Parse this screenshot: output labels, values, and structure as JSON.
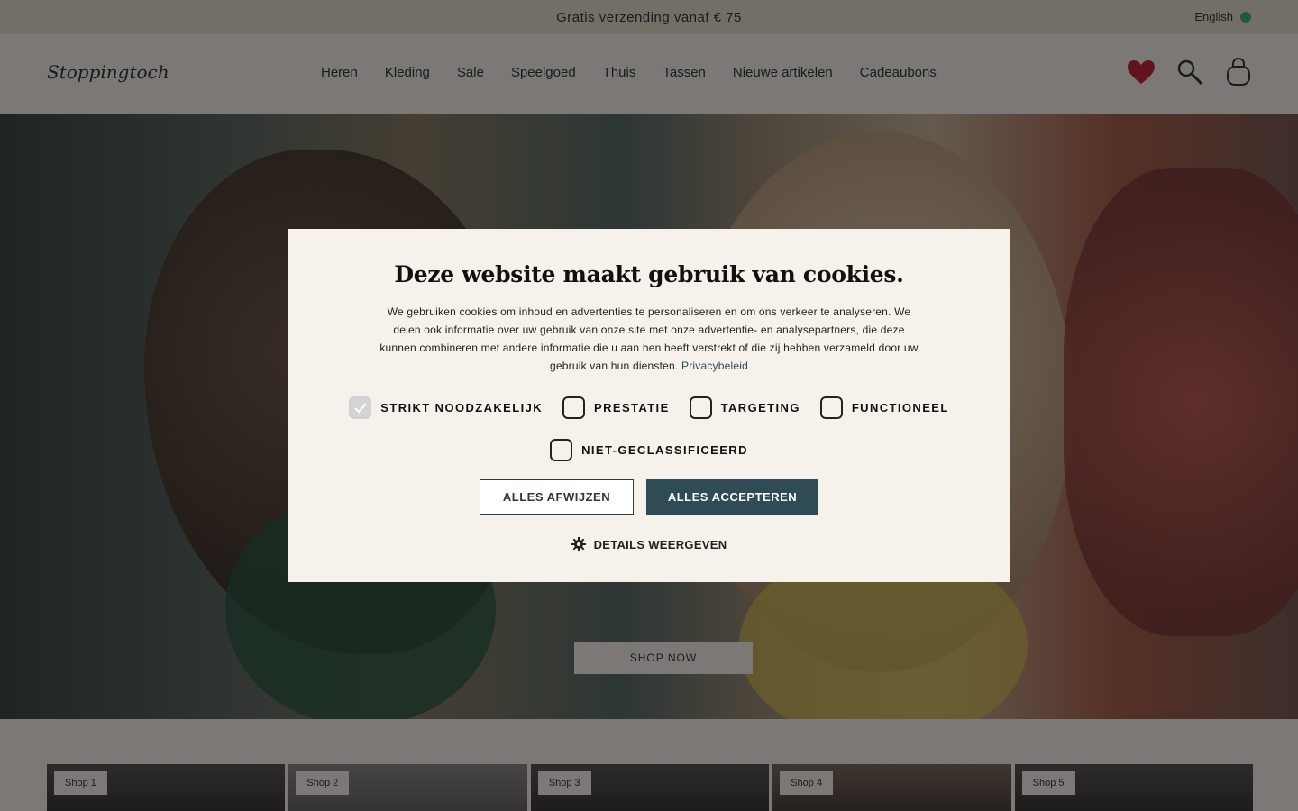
{
  "promo_bar": {
    "text": "Gratis verzending vanaf € 75",
    "language": "English"
  },
  "header": {
    "logo": "Stoppingtoch",
    "nav": [
      "Heren",
      "Kleding",
      "Sale",
      "Speelgoed",
      "Thuis",
      "Tassen",
      "Nieuwe artikelen",
      "Cadeaubons"
    ]
  },
  "hero": {
    "button_label": "SHOP NOW"
  },
  "cards": [
    {
      "tag": "Shop 1"
    },
    {
      "tag": "Shop 2"
    },
    {
      "tag": "Shop 3"
    },
    {
      "tag": "Shop 4"
    },
    {
      "tag": "Shop 5"
    }
  ],
  "cookie_dialog": {
    "title": "Deze website maakt gebruik van cookies.",
    "body": "We gebruiken cookies om inhoud en advertenties te personaliseren en om ons verkeer te analyseren. We delen ook informatie over uw gebruik van onze site met onze advertentie- en analysepartners, die deze kunnen combineren met andere informatie die u aan hen heeft verstrekt of die zij hebben verzameld door uw gebruik van hun diensten.",
    "privacy_link": "Privacybeleid",
    "options": [
      {
        "label": "STRIKT NOODZAKELIJK",
        "checked": true
      },
      {
        "label": "PRESTATIE",
        "checked": false
      },
      {
        "label": "TARGETING",
        "checked": false
      },
      {
        "label": "FUNCTIONEEL",
        "checked": false
      },
      {
        "label": "NIET-GECLASSIFICEERD",
        "checked": false
      }
    ],
    "reject_label": "ALLES AFWIJZEN",
    "accept_label": "ALLES ACCEPTEREN",
    "details_label": "DETAILS WEERGEVEN"
  },
  "colors": {
    "accent": "#2f4b55",
    "dialog_bg": "#f6f1ea",
    "heart": "#c0283a"
  }
}
